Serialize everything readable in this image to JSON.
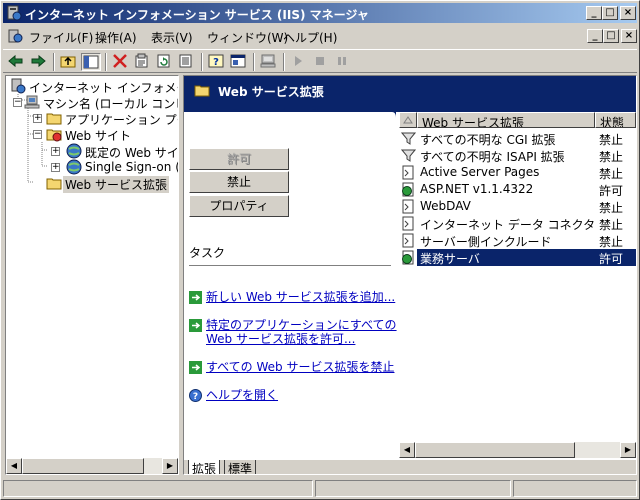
{
  "window": {
    "title": "インターネット インフォメーション サービス (IIS) マネージャ",
    "minimize_glyph": "_",
    "maximize_glyph": "□",
    "close_glyph": "×"
  },
  "menu": {
    "items": [
      "ファイル(F)",
      "操作(A)",
      "表示(V)",
      "ウィンドウ(W)",
      "ヘルプ(H)"
    ]
  },
  "tree": {
    "items": [
      {
        "label": "インターネット インフォメーション"
      },
      {
        "label": "マシン名 (ローカル コンピュ"
      },
      {
        "label": "アプリケーション プール"
      },
      {
        "label": "Web サイト"
      },
      {
        "label": "既定の Web サイト"
      },
      {
        "label": "Single Sign-on (P"
      },
      {
        "label": "Web サービス拡張"
      }
    ],
    "expander_plus": "+",
    "expander_minus": "−"
  },
  "right_pane": {
    "header_title": "Web サービス拡張",
    "buttons": {
      "allow": "許可",
      "prohibit": "禁止",
      "properties": "プロパティ"
    },
    "tasks_title": "タスク",
    "task_links": [
      "新しい Web サービス拡張を追加...",
      "特定のアプリケーションにすべての Web サービス拡張を許可...",
      "すべての Web サービス拡張を禁止",
      "ヘルプを開く"
    ]
  },
  "extension_list": {
    "columns": {
      "name": "Web サービス拡張",
      "status": "状態"
    },
    "rows": [
      {
        "name": "すべての不明な CGI 拡張",
        "status": "禁止",
        "icon": "filter-icon"
      },
      {
        "name": "すべての不明な ISAPI 拡張",
        "status": "禁止",
        "icon": "filter-icon"
      },
      {
        "name": "Active Server Pages",
        "status": "禁止",
        "icon": "document-icon"
      },
      {
        "name": "ASP.NET v1.1.4322",
        "status": "許可",
        "icon": "document-allowed-icon"
      },
      {
        "name": "WebDAV",
        "status": "禁止",
        "icon": "document-icon"
      },
      {
        "name": "インターネット データ コネクタ",
        "status": "禁止",
        "icon": "document-icon"
      },
      {
        "name": "サーバー側インクルード",
        "status": "禁止",
        "icon": "document-icon"
      },
      {
        "name": "業務サーバ",
        "status": "許可",
        "icon": "document-allowed-icon"
      }
    ],
    "selected_index": 7
  },
  "tabs": [
    {
      "label": "拡張",
      "active": true
    },
    {
      "label": "標準",
      "active": false
    }
  ],
  "colors": {
    "title_start": "#0a246a",
    "title_end": "#a6caf0",
    "selection": "#0a246a",
    "link": "#0000c0",
    "face": "#d4d0c8"
  }
}
